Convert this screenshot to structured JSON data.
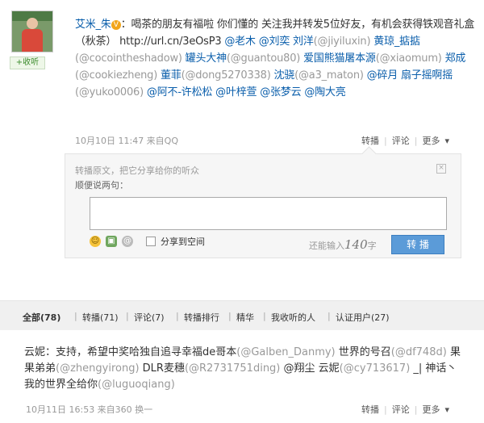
{
  "user": {
    "collect_label": "+收听"
  },
  "post": {
    "author": "艾米_朱",
    "vip_badge": "V",
    "content_1": "：喝茶的朋友有福啦 你们懂的 关注我并转发5位好友，有机会获得铁观音礼盒（秋茶） ",
    "link": "http://url.cn/3eOsP3",
    "tail": [
      {
        "t": " @老木 @刘奕 刘洋",
        "c": "u"
      },
      {
        "t": "(@jiyiluxin)",
        "c": "g"
      },
      {
        "t": " 黄琼_掂掂",
        "c": "u"
      },
      {
        "t": "(@cocointheshadow)",
        "c": "g"
      },
      {
        "t": " 罐头大神",
        "c": "u"
      },
      {
        "t": "(@guantou80)",
        "c": "g"
      },
      {
        "t": " 爱国熊猫屠本源",
        "c": "u"
      },
      {
        "t": "(@xiaomum)",
        "c": "g"
      },
      {
        "t": " 郑成",
        "c": "u"
      },
      {
        "t": "(@cookiezheng)",
        "c": "g"
      },
      {
        "t": " 董菲",
        "c": "u"
      },
      {
        "t": "(@dong5270338)",
        "c": "g"
      },
      {
        "t": " 沈骁",
        "c": "u"
      },
      {
        "t": "(@a3_maton)",
        "c": "g"
      },
      {
        "t": " @碎月 扇子摇啊摇",
        "c": "u"
      },
      {
        "t": "(@yuko0006)",
        "c": "g"
      },
      {
        "t": " @阿不-许松松 @叶梓萱 @张梦云 @陶大亮",
        "c": "u"
      }
    ],
    "time": "10月10日 11:47 来自QQ",
    "actions": [
      "转播",
      "评论",
      "更多"
    ]
  },
  "forward": {
    "original_label": "转播原文，把它分享给你的听众",
    "say_label": "顺便说两句：",
    "close_icon": "×",
    "share_space_label": "分享到空间",
    "count_prefix": "还能输入",
    "count_value": "140",
    "count_suffix": "字",
    "submit_label": "转 播"
  },
  "tabs": [
    {
      "label": "全部(78)",
      "active": true
    },
    {
      "label": "转播(71)"
    },
    {
      "label": "评论(7)"
    },
    {
      "label": "转播排行"
    },
    {
      "label": "精华"
    },
    {
      "label": "我收听的人"
    },
    {
      "label": "认证用户(27)"
    }
  ],
  "comment": {
    "parts": [
      {
        "t": "云妮：支持，希望中奖哈独自追寻幸福de哥本",
        "c": ""
      },
      {
        "t": "(@Galben_Danmy)",
        "c": "g"
      },
      {
        "t": " 世界的号召",
        "c": ""
      },
      {
        "t": "(@df748d)",
        "c": "g"
      },
      {
        "t": " 果果弟弟",
        "c": ""
      },
      {
        "t": "(@zhengyirong)",
        "c": "g"
      },
      {
        "t": " DLR麦穗",
        "c": ""
      },
      {
        "t": "(@R2731751ding)",
        "c": "g"
      },
      {
        "t": " @翔尘 云妮",
        "c": ""
      },
      {
        "t": "(@cy713617)",
        "c": "g"
      },
      {
        "t": " _| 神话丶我的世界全给你",
        "c": ""
      },
      {
        "t": "(@luguoqiang)",
        "c": "g"
      }
    ],
    "time": "10月11日 16:53 来自360 换一",
    "actions": [
      "转播",
      "评论",
      "更多"
    ]
  }
}
